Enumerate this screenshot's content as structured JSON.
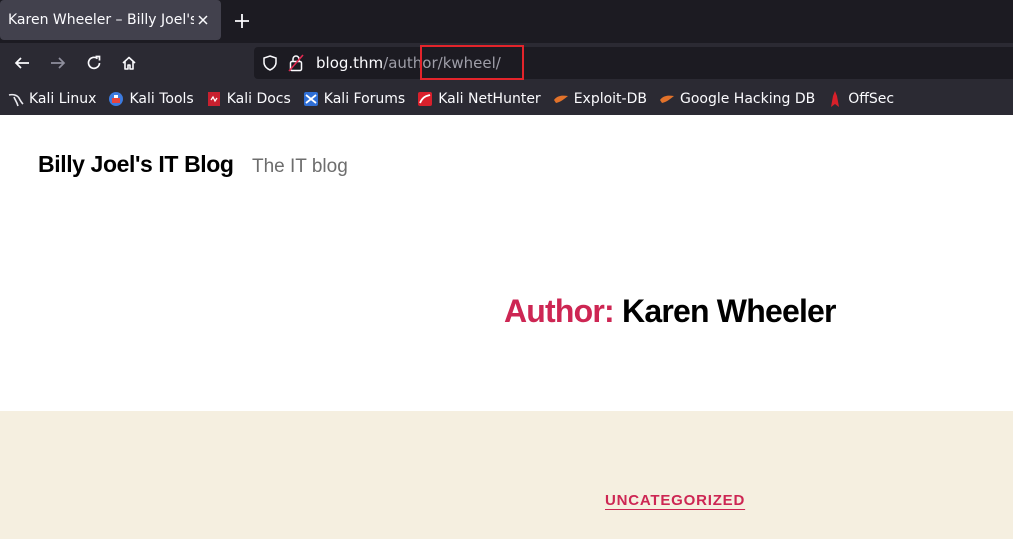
{
  "browser": {
    "tab": {
      "title": "Karen Wheeler – Billy Joel's IT Blog",
      "close_icon": "close-icon"
    },
    "new_tab_icon": "plus-icon",
    "nav": {
      "back_icon": "arrow-left-icon",
      "forward_icon": "arrow-right-icon",
      "reload_icon": "reload-icon",
      "home_icon": "home-icon"
    },
    "url": {
      "host": "blog.thm",
      "path": "/author/kwheel/"
    },
    "highlight_color": "#e3242b",
    "bookmarks": [
      {
        "label": "Kali Linux",
        "icon": "kali-dragon-icon"
      },
      {
        "label": "Kali Tools",
        "icon": "kali-tools-icon"
      },
      {
        "label": "Kali Docs",
        "icon": "kali-docs-icon"
      },
      {
        "label": "Kali Forums",
        "icon": "kali-forums-icon"
      },
      {
        "label": "Kali NetHunter",
        "icon": "nethunter-icon"
      },
      {
        "label": "Exploit-DB",
        "icon": "exploit-db-icon"
      },
      {
        "label": "Google Hacking DB",
        "icon": "ghdb-icon"
      },
      {
        "label": "OffSec",
        "icon": "offsec-icon"
      }
    ]
  },
  "site": {
    "title": "Billy Joel's IT Blog",
    "description": "The IT blog",
    "archive_prefix": "Author:",
    "archive_name": "Karen Wheeler",
    "category": "UNCATEGORIZED",
    "accent_color": "#cd2653",
    "band_color": "#f5efe0"
  }
}
